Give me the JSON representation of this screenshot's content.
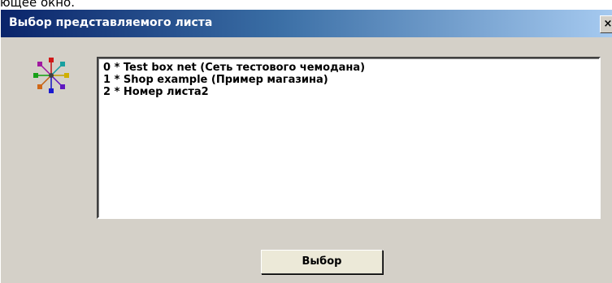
{
  "background_caption": "ющее окно.",
  "dialog": {
    "title": "Выбор представляемого листа",
    "close_label": "×",
    "icon": "network-nodes-icon",
    "list": {
      "items": [
        "0 * Test box net (Сеть тестового чемодана)",
        "1 * Shop example (Пример магазина)",
        "2 * Номер листа2"
      ]
    },
    "select_button": "Выбор"
  },
  "colors": {
    "dialog_face": "#d4d0c8",
    "titlebar_start": "#0a246a",
    "titlebar_end": "#a6caf0"
  }
}
